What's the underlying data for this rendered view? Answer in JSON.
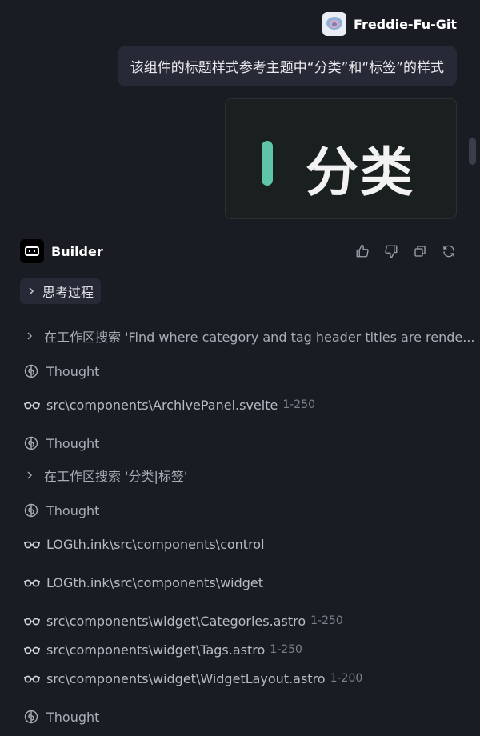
{
  "user": {
    "name": "Freddie-Fu-Git",
    "message": "该组件的标题样式参考主题中“分类”和“标签”的样式",
    "image": {
      "text": "分类",
      "accent": "#5ec4aa"
    }
  },
  "builder": {
    "name": "Builder",
    "actions": [
      "thumbs-up-icon",
      "thumbs-down-icon",
      "copy-icon",
      "refresh-icon"
    ],
    "thinking_label": "思考过程"
  },
  "steps": [
    {
      "kind": "search",
      "text": "在工作区搜索 'Find where category and tag header titles are rende..."
    },
    {
      "kind": "thought",
      "text": "Thought"
    },
    {
      "kind": "read",
      "path": "src\\components\\ArchivePanel.svelte",
      "range": "1-250"
    },
    {
      "kind": "thought",
      "text": "Thought"
    },
    {
      "kind": "search",
      "text": "在工作区搜索 '分类|标签'"
    },
    {
      "kind": "thought",
      "text": "Thought"
    },
    {
      "kind": "read",
      "path": "LOGth.ink\\src\\components\\control",
      "range": ""
    },
    {
      "kind": "read",
      "path": "LOGth.ink\\src\\components\\widget",
      "range": ""
    },
    {
      "kind": "read",
      "path": "src\\components\\widget\\Categories.astro",
      "range": "1-250"
    },
    {
      "kind": "read",
      "path": "src\\components\\widget\\Tags.astro",
      "range": "1-250"
    },
    {
      "kind": "read",
      "path": "src\\components\\widget\\WidgetLayout.astro",
      "range": "1-200"
    },
    {
      "kind": "thought",
      "text": "Thought"
    }
  ]
}
